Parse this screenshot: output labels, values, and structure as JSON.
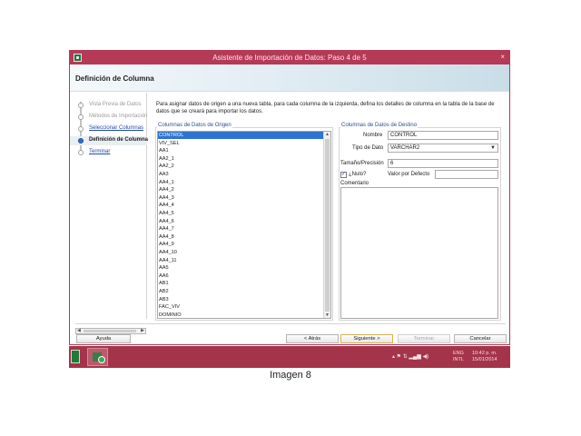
{
  "window": {
    "title": "Asistente de Importación de Datos: Paso 4 de 5",
    "close_glyph": "×",
    "heading": "Definición de Columna"
  },
  "steps": [
    {
      "label": "Vista Previa de Datos",
      "state": "done"
    },
    {
      "label": "Métodos de Importación",
      "state": "done"
    },
    {
      "label": "Seleccionar Columnas",
      "state": "link"
    },
    {
      "label": "Definición de Columna",
      "state": "current"
    },
    {
      "label": "Terminar",
      "state": "link"
    }
  ],
  "instructions": "Para asignar datos de origen a una nueva tabla, para cada columna de la izquierda, defina los detalles de columna en la tabla de la base de datos que se creará para importar los datos.",
  "source": {
    "group_label": "Columnas de Datos de Origen",
    "selected": "CONTROL",
    "items": [
      "CONTROL",
      "VIV_SEL",
      "AA1",
      "AA2_1",
      "AA2_2",
      "AA3",
      "AA4_1",
      "AA4_2",
      "AA4_3",
      "AA4_4",
      "AA4_5",
      "AA4_6",
      "AA4_7",
      "AA4_8",
      "AA4_9",
      "AA4_10",
      "AA4_11",
      "AA5",
      "AA6",
      "AB1",
      "AB2",
      "AB3",
      "FAC_VIV",
      "DOMINIO"
    ]
  },
  "target": {
    "group_label": "Columnas de Datos de Destino",
    "name_label": "Nombre",
    "name_value": "CONTROL",
    "type_label": "Tipo de Dato",
    "type_value": "VARCHAR2",
    "size_label": "Tamaño/Precisión",
    "size_value": "6",
    "nullable_label": "¿Nulo?",
    "nullable_checked": true,
    "default_label": "Valor por Defecto",
    "default_value": "",
    "comment_label": "Comentario"
  },
  "buttons": {
    "help": "Ayuda",
    "back": "< Atrás",
    "next": "Siguiente >",
    "finish": "Terminar",
    "cancel": "Cancelar"
  },
  "taskbar": {
    "lang": "ENG",
    "region": "INTL",
    "time": "10:42 p. m.",
    "date": "15/01/2014"
  },
  "caption": "Imagen 8",
  "colors": {
    "titlebar": "#b43a55",
    "selection": "#2f73d1",
    "taskbar": "#a3344a"
  }
}
